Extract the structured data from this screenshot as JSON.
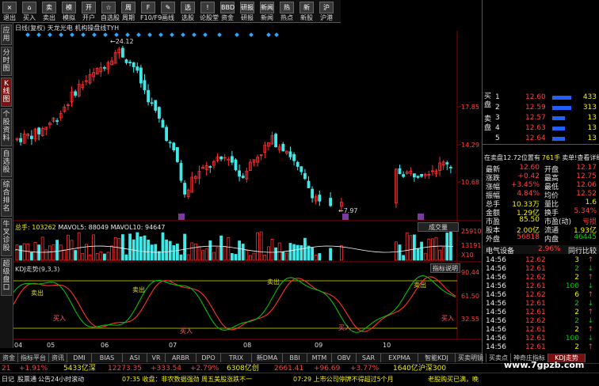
{
  "toolbar": {
    "buttons": [
      {
        "icon": "×",
        "label": "退出"
      },
      {
        "icon": "⌂",
        "label": "买入"
      },
      {
        "icon": "卖",
        "label": "卖出"
      },
      {
        "icon": "模",
        "label": "模拟"
      },
      {
        "icon": "开",
        "label": "开户"
      },
      {
        "icon": "☆",
        "label": "自选股"
      },
      {
        "icon": "周",
        "label": "周期"
      },
      {
        "icon": "F",
        "label": "F10/F9"
      },
      {
        "icon": "✎",
        "label": "画线"
      },
      {
        "icon": "选",
        "label": "选股"
      },
      {
        "icon": "!",
        "label": "论股堂"
      },
      {
        "icon": "BBD",
        "label": "资金"
      },
      {
        "icon": "研报",
        "label": "研报"
      },
      {
        "icon": "新闻",
        "label": "新闻"
      },
      {
        "icon": "热",
        "label": "热点"
      },
      {
        "icon": "新",
        "label": "新股"
      },
      {
        "icon": "沪",
        "label": "沪港"
      }
    ]
  },
  "left_nav": [
    "应用",
    "分时图",
    "K线图",
    "个股资料",
    "自选股",
    "综合排名",
    "牛叉诊股",
    "超级盘口"
  ],
  "chart": {
    "title_line": "日线(复权) 天龙光电 机构操盘线TYH",
    "price_axis": [
      "17.85",
      "14.29",
      "10.68"
    ],
    "high_label": "24.12",
    "low_label": "7.97",
    "volume_legend": {
      "vol": "总手: 103262",
      "ma5": "MAVOL5: 88049",
      "ma10": "MAVOL10: 94647"
    },
    "volume_button": "成交量",
    "volume_axis": [
      "25910",
      "13191",
      "X10"
    ],
    "kdj_legend": "KDJ走势(9,3,3)",
    "kdj_button": "指标说明",
    "kdj_axis": [
      "90.44",
      "61.50",
      "32.55"
    ],
    "x_labels": [
      "04",
      "05",
      "06",
      "07",
      "08",
      "09",
      "10",
      "11"
    ],
    "kdj_marks": [
      "卖出",
      "买入",
      "卖出",
      "买入",
      "卖出",
      "买入",
      "卖出",
      "买入"
    ]
  },
  "order_book": {
    "sell_label": "卖盘",
    "buy_label": "买盘",
    "sell": [
      {
        "lvl": "5",
        "price": "12.64",
        "vol": "13"
      },
      {
        "lvl": "4",
        "price": "12.63",
        "vol": "13"
      },
      {
        "lvl": "3",
        "price": "12.57",
        "vol": "13"
      },
      {
        "lvl": "2",
        "price": "12.59",
        "vol": "313"
      },
      {
        "lvl": "1",
        "price": "12.60",
        "vol": "433"
      }
    ],
    "buy": [
      {
        "lvl": "1",
        "price": "12.60",
        "vol": "433"
      },
      {
        "lvl": "2",
        "price": "12.59",
        "vol": "313"
      },
      {
        "lvl": "3",
        "price": "12.57",
        "vol": "13"
      },
      {
        "lvl": "4",
        "price": "12.63",
        "vol": "13"
      },
      {
        "lvl": "5",
        "price": "12.64",
        "vol": "13"
      }
    ],
    "summary_header": {
      "left": "在卖盘12.72位置有",
      "mid": "761手",
      "right": "卖单!查看详细"
    },
    "stats": [
      [
        "最新",
        "12.60",
        "开盘",
        "12.17"
      ],
      [
        "涨跌",
        "+0.42",
        "最高",
        "12.75"
      ],
      [
        "涨幅",
        "+3.45%",
        "最低",
        "12.06"
      ],
      [
        "振幅",
        "4.84%",
        "均价",
        "12.52"
      ],
      [
        "总手",
        "10.33万",
        "量比",
        "1.6"
      ],
      [
        "金额",
        "1.29亿",
        "换手",
        "5.34%"
      ],
      [
        "市盈",
        "85.50",
        "市盈(动)",
        "亏损"
      ],
      [
        "股本",
        "2.00亿",
        "流通",
        "1.93亿"
      ],
      [
        "外盘",
        "56818",
        "内盘",
        "46445"
      ]
    ],
    "industry": {
      "name": "电气设备",
      "pct": "2.96%",
      "link": "同行比较"
    },
    "ticks": [
      [
        "14:56",
        "12.62",
        "3"
      ],
      [
        "14:56",
        "12.61",
        "2"
      ],
      [
        "14:56",
        "12.62",
        "2"
      ],
      [
        "14:56",
        "12.61",
        "100"
      ],
      [
        "14:56",
        "12.62",
        "6"
      ],
      [
        "14:56",
        "12.61",
        "2"
      ],
      [
        "14:56",
        "12.61",
        "2"
      ],
      [
        "14:56",
        "12.62",
        "2"
      ],
      [
        "14:56",
        "12.61",
        "2"
      ],
      [
        "14:56",
        "12.61",
        "100"
      ],
      [
        "14:56",
        "12.61",
        "2"
      ]
    ]
  },
  "tabs": [
    "资金",
    "指标平台",
    "资讯",
    "DMI",
    "BIAS",
    "ASI",
    "VR",
    "ARBR",
    "DPO",
    "TRIX",
    "新DMA",
    "BBI",
    "MTM",
    "OBV",
    "SAR",
    "EXPMA",
    "智能KDJ",
    "买卖明镜",
    "买卖点",
    "神奇庄指标",
    "KDJ走势"
  ],
  "status": {
    "idx1": "21",
    "idx1_pct": "+1.91%",
    "sz": "5433亿深",
    "sz_val": "12273.35",
    "sz_chg": "+333.54",
    "sz_pct": "+2.79%",
    "cy": "6308亿创",
    "cy_val": "2661.41",
    "cy_chg": "+96.69",
    "cy_pct": "+3.77%",
    "hs": "1640亿沪深300"
  },
  "ticker": {
    "left": "日记",
    "btn1": "股票通",
    "btn2": "公告",
    "btn3": "24小时滚动",
    "news1": "07:35 收盘：非农数据强劲 周五美股涨跌不一",
    "news2": "07:29 上市公司停牌不得超过5个月",
    "news3": "老股购买已满，晚",
    "watermark": "www.7gpzb.com"
  },
  "colors": {
    "up": "#ff3030",
    "down": "#40e8e8",
    "k": "#ffffff",
    "d": "#e0e000",
    "j": "#ff00ff",
    "ma": "#ffff00"
  }
}
